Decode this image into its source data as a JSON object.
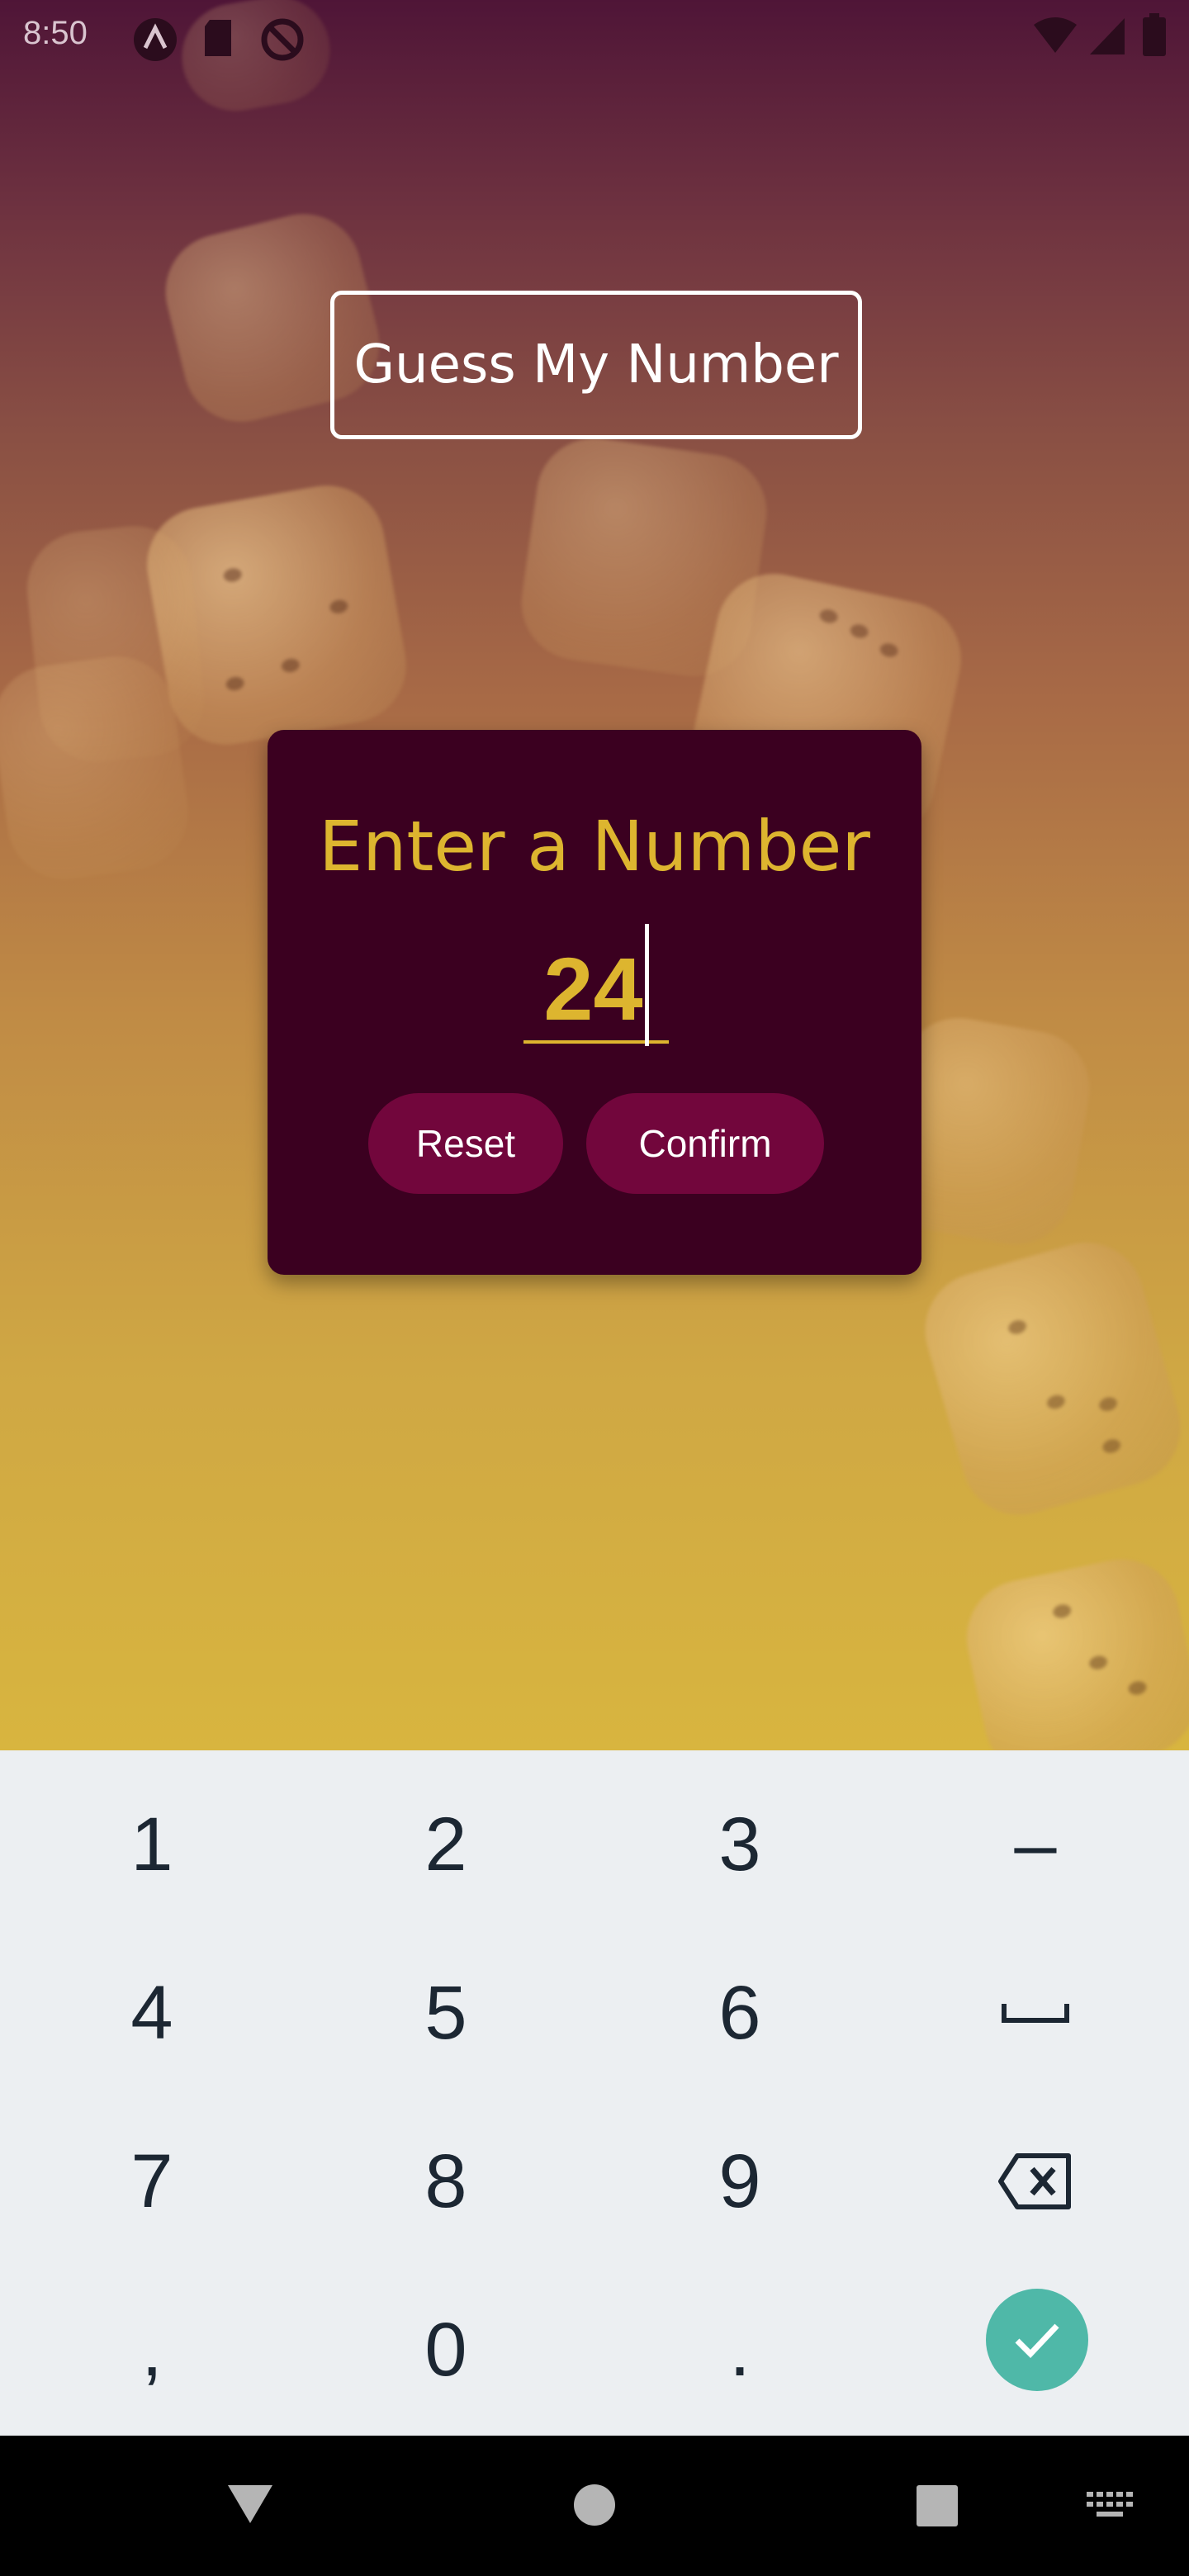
{
  "status_bar": {
    "time": "8:50"
  },
  "app": {
    "title": "Guess My Number",
    "card": {
      "heading": "Enter a Number",
      "input_value": "24",
      "reset_label": "Reset",
      "confirm_label": "Confirm"
    }
  },
  "keyboard": {
    "keys": [
      "1",
      "2",
      "3",
      "–",
      "4",
      "5",
      "6",
      "␣",
      "7",
      "8",
      "9",
      "⌫",
      ",",
      "0",
      ".",
      "✓"
    ],
    "row1": [
      "1",
      "2",
      "3",
      "–"
    ],
    "row2": [
      "4",
      "5",
      "6"
    ],
    "row3": [
      "7",
      "8",
      "9"
    ],
    "row4": [
      ",",
      "0",
      "."
    ]
  },
  "colors": {
    "accent": "#ddb52f",
    "card": "#3b0020",
    "button": "#72063c",
    "done_key": "#4fb8a8"
  }
}
